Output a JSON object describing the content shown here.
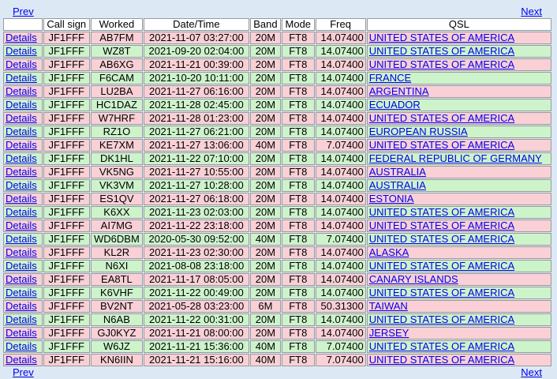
{
  "nav": {
    "prev": "Prev",
    "next": "Next"
  },
  "headers": [
    "",
    "Call sign",
    "Worked",
    "Date/Time",
    "Band",
    "Mode",
    "Freq",
    "QSL"
  ],
  "details_label": "Details",
  "rows": [
    {
      "call": "JF1FFF",
      "worked": "AB7FM",
      "dt": "2021-11-07 03:27:00",
      "band": "20M",
      "mode": "FT8",
      "freq": "14.07400",
      "qsl": "UNITED STATES OF AMERICA",
      "color": "pink"
    },
    {
      "call": "JF1FFF",
      "worked": "WZ8T",
      "dt": "2021-09-20 02:04:00",
      "band": "20M",
      "mode": "FT8",
      "freq": "14.07400",
      "qsl": "UNITED STATES OF AMERICA",
      "color": "green"
    },
    {
      "call": "JF1FFF",
      "worked": "AB6XG",
      "dt": "2021-11-21 00:39:00",
      "band": "20M",
      "mode": "FT8",
      "freq": "14.07400",
      "qsl": "UNITED STATES OF AMERICA",
      "color": "pink"
    },
    {
      "call": "JF1FFF",
      "worked": "F6CAM",
      "dt": "2021-10-20 10:11:00",
      "band": "20M",
      "mode": "FT8",
      "freq": "14.07400",
      "qsl": "FRANCE",
      "color": "green"
    },
    {
      "call": "JF1FFF",
      "worked": "LU2BA",
      "dt": "2021-11-27 06:16:00",
      "band": "20M",
      "mode": "FT8",
      "freq": "14.07400",
      "qsl": "ARGENTINA",
      "color": "pink"
    },
    {
      "call": "JF1FFF",
      "worked": "HC1DAZ",
      "dt": "2021-11-28 02:45:00",
      "band": "20M",
      "mode": "FT8",
      "freq": "14.07400",
      "qsl": "ECUADOR",
      "color": "green"
    },
    {
      "call": "JF1FFF",
      "worked": "W7HRF",
      "dt": "2021-11-28 01:23:00",
      "band": "20M",
      "mode": "FT8",
      "freq": "14.07400",
      "qsl": "UNITED STATES OF AMERICA",
      "color": "pink"
    },
    {
      "call": "JF1FFF",
      "worked": "RZ1O",
      "dt": "2021-11-27 06:21:00",
      "band": "20M",
      "mode": "FT8",
      "freq": "14.07400",
      "qsl": "EUROPEAN RUSSIA",
      "color": "green"
    },
    {
      "call": "JF1FFF",
      "worked": "KE7XM",
      "dt": "2021-11-27 13:06:00",
      "band": "40M",
      "mode": "FT8",
      "freq": "7.07400",
      "qsl": "UNITED STATES OF AMERICA",
      "color": "pink"
    },
    {
      "call": "JF1FFF",
      "worked": "DK1HL",
      "dt": "2021-11-22 07:10:00",
      "band": "20M",
      "mode": "FT8",
      "freq": "14.07400",
      "qsl": "FEDERAL REPUBLIC OF GERMANY",
      "color": "green"
    },
    {
      "call": "JF1FFF",
      "worked": "VK5NG",
      "dt": "2021-11-27 10:55:00",
      "band": "20M",
      "mode": "FT8",
      "freq": "14.07400",
      "qsl": "AUSTRALIA",
      "color": "pink"
    },
    {
      "call": "JF1FFF",
      "worked": "VK3VM",
      "dt": "2021-11-27 10:28:00",
      "band": "20M",
      "mode": "FT8",
      "freq": "14.07400",
      "qsl": "AUSTRALIA",
      "color": "green"
    },
    {
      "call": "JF1FFF",
      "worked": "ES1QV",
      "dt": "2021-11-27 06:18:00",
      "band": "20M",
      "mode": "FT8",
      "freq": "14.07400",
      "qsl": "ESTONIA",
      "color": "pink"
    },
    {
      "call": "JF1FFF",
      "worked": "K6XX",
      "dt": "2021-11-23 02:03:00",
      "band": "20M",
      "mode": "FT8",
      "freq": "14.07400",
      "qsl": "UNITED STATES OF AMERICA",
      "color": "green"
    },
    {
      "call": "JF1FFF",
      "worked": "AI7MG",
      "dt": "2021-11-22 23:18:00",
      "band": "20M",
      "mode": "FT8",
      "freq": "14.07400",
      "qsl": "UNITED STATES OF AMERICA",
      "color": "pink"
    },
    {
      "call": "JF1FFF",
      "worked": "WD6DBM",
      "dt": "2020-05-30 09:52:00",
      "band": "40M",
      "mode": "FT8",
      "freq": "7.07400",
      "qsl": "UNITED STATES OF AMERICA",
      "color": "green"
    },
    {
      "call": "JF1FFF",
      "worked": "KL2R",
      "dt": "2021-11-23 02:30:00",
      "band": "20M",
      "mode": "FT8",
      "freq": "14.07400",
      "qsl": "ALASKA",
      "color": "pink"
    },
    {
      "call": "JF1FFF",
      "worked": "N6XI",
      "dt": "2021-08-08 23:18:00",
      "band": "20M",
      "mode": "FT8",
      "freq": "14.07400",
      "qsl": "UNITED STATES OF AMERICA",
      "color": "green"
    },
    {
      "call": "JF1FFF",
      "worked": "EA8TL",
      "dt": "2021-11-17 08:05:00",
      "band": "20M",
      "mode": "FT8",
      "freq": "14.07400",
      "qsl": "CANARY ISLANDS",
      "color": "pink"
    },
    {
      "call": "JF1FFF",
      "worked": "K6VHF",
      "dt": "2021-11-22 00:49:00",
      "band": "20M",
      "mode": "FT8",
      "freq": "14.07400",
      "qsl": "UNITED STATES OF AMERICA",
      "color": "green"
    },
    {
      "call": "JF1FFF",
      "worked": "BV2NT",
      "dt": "2021-05-28 03:23:00",
      "band": "6M",
      "mode": "FT8",
      "freq": "50.31300",
      "qsl": "TAIWAN",
      "color": "pink"
    },
    {
      "call": "JF1FFF",
      "worked": "N6AB",
      "dt": "2021-11-22 00:31:00",
      "band": "20M",
      "mode": "FT8",
      "freq": "14.07400",
      "qsl": "UNITED STATES OF AMERICA",
      "color": "green"
    },
    {
      "call": "JF1FFF",
      "worked": "GJ0KYZ",
      "dt": "2021-11-21 08:00:00",
      "band": "20M",
      "mode": "FT8",
      "freq": "14.07400",
      "qsl": "JERSEY",
      "color": "pink"
    },
    {
      "call": "JF1FFF",
      "worked": "W6JZ",
      "dt": "2021-11-21 15:36:00",
      "band": "40M",
      "mode": "FT8",
      "freq": "7.07400",
      "qsl": "UNITED STATES OF AMERICA",
      "color": "green"
    },
    {
      "call": "JF1FFF",
      "worked": "KN6IIN",
      "dt": "2021-11-21 15:16:00",
      "band": "40M",
      "mode": "FT8",
      "freq": "7.07400",
      "qsl": "UNITED STATES OF AMERICA",
      "color": "pink"
    }
  ]
}
